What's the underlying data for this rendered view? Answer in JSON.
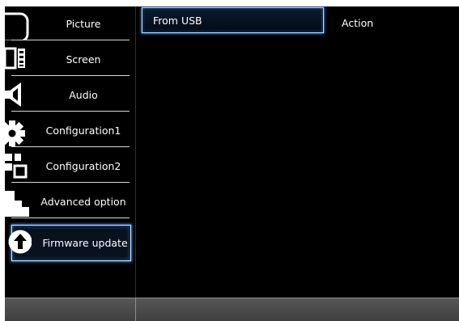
{
  "menu": {
    "items": [
      {
        "label": "Picture",
        "icon": "tv-icon"
      },
      {
        "label": "Screen",
        "icon": "film-screen-icon"
      },
      {
        "label": "Audio",
        "icon": "speaker-icon"
      },
      {
        "label": "Configuration1",
        "icon": "gear-icon"
      },
      {
        "label": "Configuration2",
        "icon": "grid-blocks-icon"
      },
      {
        "label": "Advanced option",
        "icon": "steps-icon"
      },
      {
        "label": "Firmware update",
        "icon": "upload-arrow-icon",
        "selected": true
      }
    ]
  },
  "options": {
    "selected_label": "From USB"
  },
  "action": {
    "header": "Action"
  },
  "colors": {
    "background": "#000000",
    "highlight_border": "#cfe6ff",
    "highlight_glow": "#50a0ff",
    "footer": "#4a4a4a"
  }
}
